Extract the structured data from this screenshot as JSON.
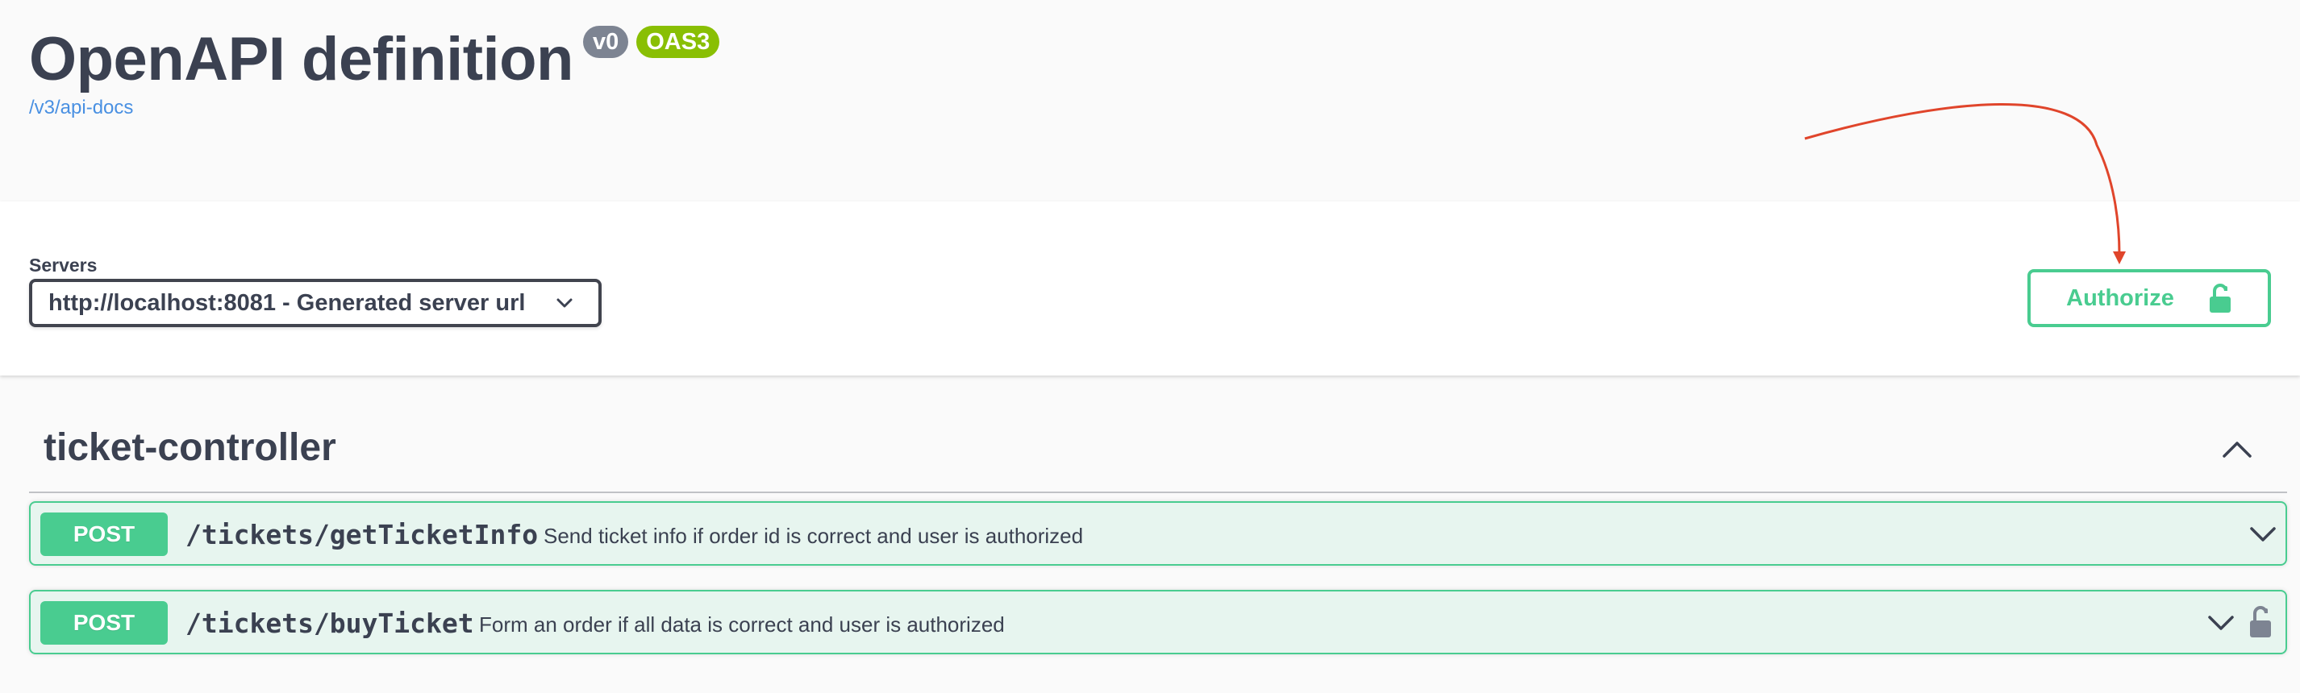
{
  "info": {
    "title": "OpenAPI definition",
    "version_badge": "v0",
    "oas_badge": "OAS3",
    "doc_link": "/v3/api-docs"
  },
  "servers": {
    "label": "Servers",
    "selected": "http://localhost:8081 - Generated server url"
  },
  "authorize": {
    "label": "Authorize"
  },
  "tag": {
    "name": "ticket-controller",
    "expanded": true
  },
  "operations": [
    {
      "method": "POST",
      "path": "/tickets/getTicketInfo",
      "summary": "Send ticket info if order id is correct and user is authorized",
      "locked": false
    },
    {
      "method": "POST",
      "path": "/tickets/buyTicket",
      "summary": "Form an order if all data is correct and user is authorized",
      "locked": true
    }
  ],
  "colors": {
    "post": "#49cc90",
    "text": "#3b4151",
    "link": "#4990e2",
    "version_badge": "#7d8492",
    "oas_badge": "#89bf04",
    "annotation_arrow": "#e0452b"
  },
  "icons": {
    "server_select": "chevron-down-icon",
    "authorize": "lock-open-icon",
    "tag_toggle": "chevron-up-icon",
    "operation_expand": "chevron-down-icon",
    "operation_lock": "lock-open-icon"
  }
}
